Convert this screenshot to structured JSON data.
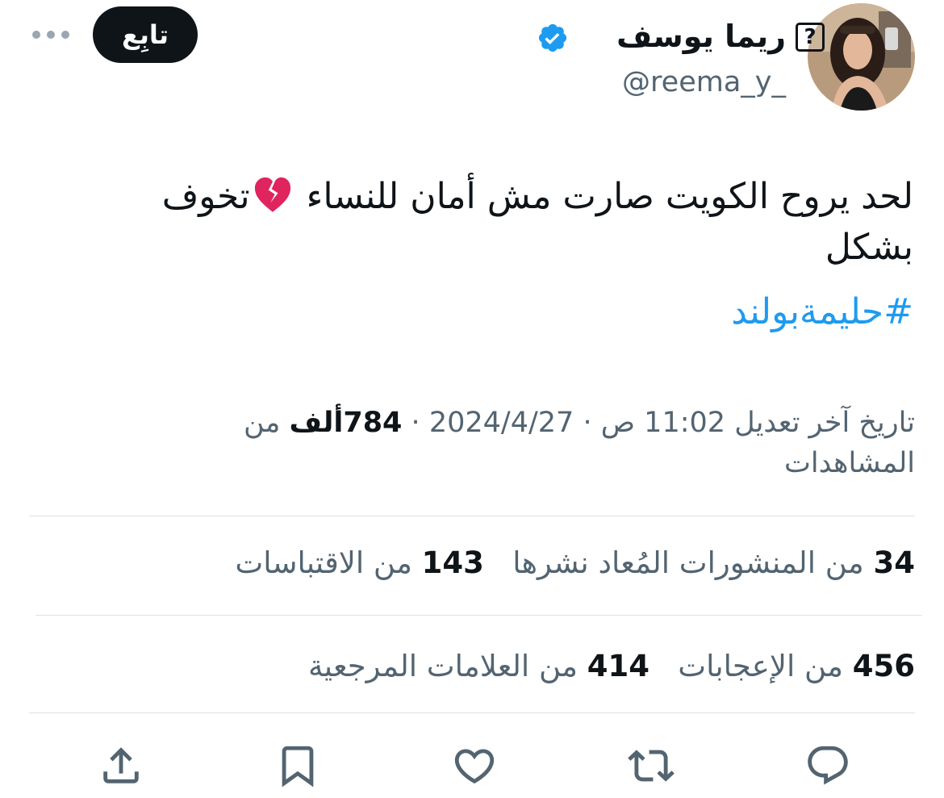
{
  "author": {
    "name": "ريما يوسف",
    "unknown_glyph": "?",
    "handle": "@reema_y_",
    "verified": true,
    "verified_color": "#1d9bf0"
  },
  "header": {
    "follow_label": "تابِع",
    "more_icon": "more-horizontal-icon"
  },
  "tweet": {
    "text_part1": "لحد يروح الكويت صارت مش أمان للنساء ",
    "emoji": "broken-heart",
    "text_part2": "تخوف بشكل",
    "hashtag": "#حليمةبولند"
  },
  "meta": {
    "edited_label": "تاريخ آخر تعديل",
    "time": "11:02 ص",
    "date": "2024/4/27",
    "separator": "·",
    "views_count": "784ألف",
    "views_label": "من المشاهدات"
  },
  "stats": {
    "reposts_count": "34",
    "reposts_label": "من المنشورات المُعاد نشرها",
    "quotes_count": "143",
    "quotes_label": "من الاقتباسات",
    "likes_count": "456",
    "likes_label": "من الإعجابات",
    "bookmarks_count": "414",
    "bookmarks_label": "من العلامات المرجعية"
  },
  "actions": [
    "reply-icon",
    "repost-icon",
    "like-icon",
    "bookmark-icon",
    "share-icon"
  ],
  "colors": {
    "text": "#0f1419",
    "secondary": "#536471",
    "link": "#1d9bf0",
    "divider": "#dfe3e7"
  }
}
